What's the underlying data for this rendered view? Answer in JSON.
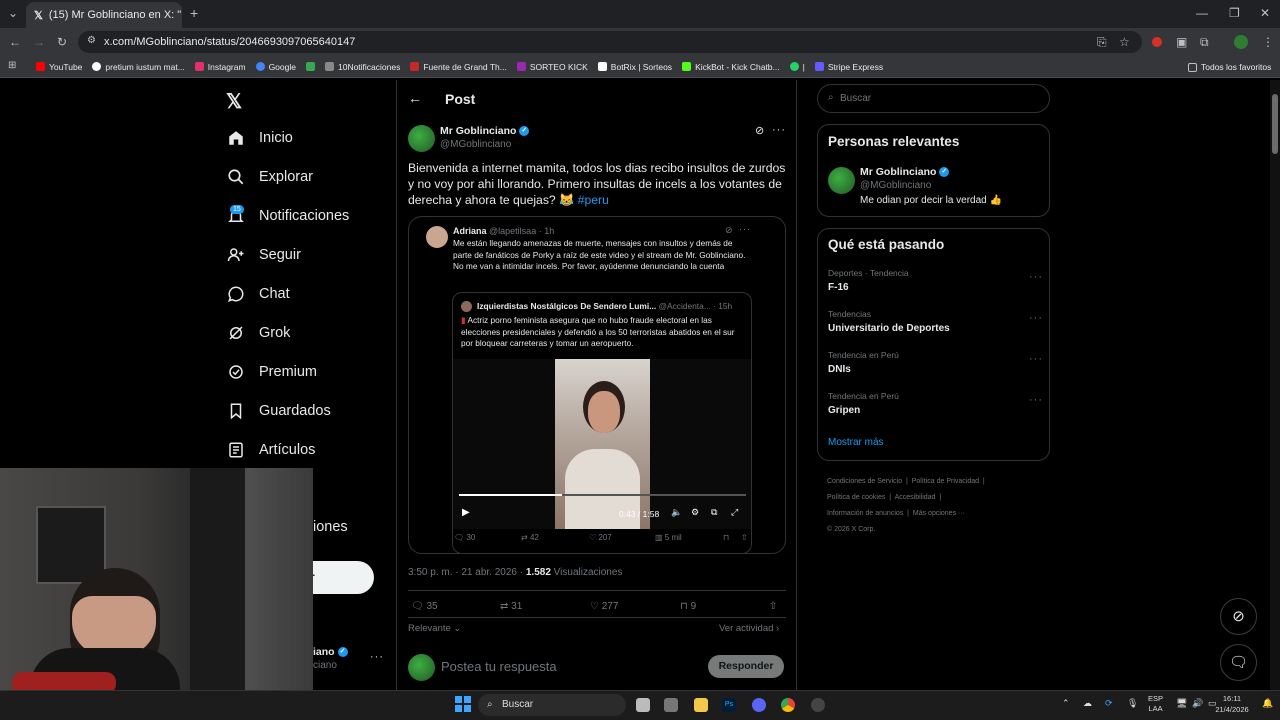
{
  "browser": {
    "tab_title": "(15) Mr Goblinciano en X: \"Bie",
    "url": "x.com/MGoblinciano/status/2046693097065640147",
    "bookmarks": [
      "YouTube",
      "pretium iustum mat...",
      "Instagram",
      "Google",
      "10Notificaciones",
      "Fuente de Grand Th...",
      "SORTEO KICK",
      "BotRix | Sorteos",
      "KickBot - Kick Chatb...",
      "Stripe Express"
    ],
    "all_favorites": "Todos los favoritos"
  },
  "nav": {
    "items": [
      "Inicio",
      "Explorar",
      "Notificaciones",
      "Seguir",
      "Chat",
      "Grok",
      "Premium",
      "Guardados",
      "Artículos"
    ],
    "notif_badge": "15",
    "partial_item": "iones",
    "partial_user_name": "iano",
    "partial_user_handle": "ciano"
  },
  "post": {
    "header": "Post",
    "author_name": "Mr Goblinciano",
    "author_handle": "@MGoblinciano",
    "text": "Bienvenida a internet mamita, todos los dias recibo insultos de zurdos y no voy por ahi llorando. Primero insultas de incels a los votantes de derecha y ahora te quejas? 😹",
    "hashtag": "#peru",
    "quote": {
      "name": "Adriana",
      "handle": "@lapetilsaa · 1h",
      "text": "Me están llegando amenazas de muerte, mensajes con insultos y demás de parte de fanáticos de Porky a raíz de este video y el stream de Mr. Goblinciano. No me van a intimidar incels. Por favor, ayúdenme denunciando la cuenta",
      "nested": {
        "name": "Izquierdistas Nostálgicos De Sendero Lumi...",
        "handle": "@Accidenta... · 15h",
        "text": "Actriz porno feminista asegura que no hubo fraude electoral en las elecciones presidenciales y defendió a los 50 terroristas abatidos en el sur por bloquear carreteras y tomar un aeropuerto."
      },
      "video_time": "0:43 / 1:58",
      "video_progress": 0.36,
      "stats": [
        "30",
        "42",
        "207",
        "5 mil"
      ]
    },
    "timestamp": "3:50 p. m. · 21 abr. 2026 · ",
    "views_count": "1.582",
    "views_label": "Visualizaciones",
    "actions": [
      "35",
      "31",
      "277",
      "9"
    ],
    "relevance": "Relevante",
    "activity": "Ver actividad",
    "reply_placeholder": "Postea tu respuesta",
    "reply_button": "Responder"
  },
  "search": {
    "placeholder": "Buscar"
  },
  "relevant": {
    "title": "Personas relevantes",
    "name": "Mr Goblinciano",
    "handle": "@MGoblinciano",
    "bio": "Me odian por decir la verdad 👍"
  },
  "trends": {
    "title": "Qué está pasando",
    "items": [
      {
        "cat": "Deportes · Tendencia",
        "name": "F-16"
      },
      {
        "cat": "Tendencias",
        "name": "Universitario de Deportes"
      },
      {
        "cat": "Tendencia en Perú",
        "name": "DNIs"
      },
      {
        "cat": "Tendencia en Perú",
        "name": "Gripen"
      }
    ],
    "more": "Mostrar más"
  },
  "footer": [
    "Condiciones de Servicio",
    "Política de Privacidad",
    "Política de cookies",
    "Accesibilidad",
    "Información de anuncios",
    "Más opciones ···",
    "© 2026 X Corp."
  ],
  "taskbar": {
    "search": "Buscar",
    "lang1": "ESP",
    "lang2": "LAA",
    "time": "16:11",
    "date": "21/4/2026"
  },
  "colors": {
    "accent": "#1d9bf0",
    "bg": "#000000",
    "border": "#2f3336"
  }
}
